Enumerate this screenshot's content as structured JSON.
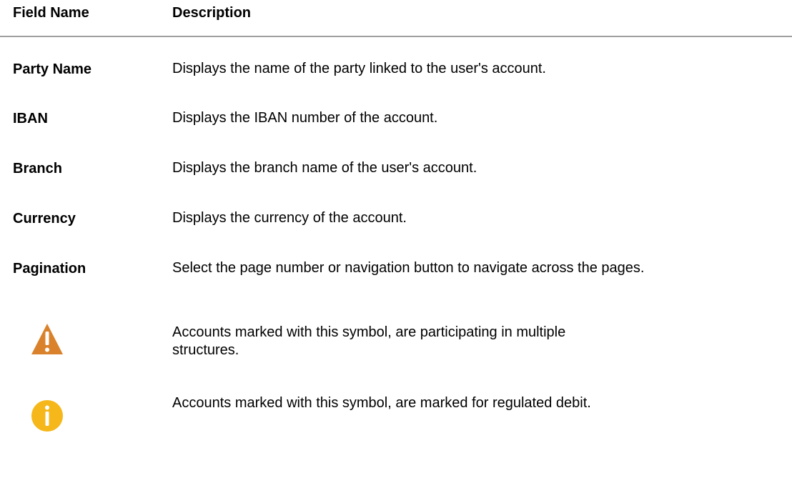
{
  "header": {
    "field_name": "Field Name",
    "description": "Description"
  },
  "rows": [
    {
      "field": "Party Name",
      "description": "Displays the name of the party linked to the user's account."
    },
    {
      "field": "IBAN",
      "description": "Displays the IBAN number of the account."
    },
    {
      "field": "Branch",
      "description": "Displays the branch name of the user's account."
    },
    {
      "field": "Currency",
      "description": "Displays the currency of the account."
    },
    {
      "field": "Pagination",
      "description": "Select the page number or navigation button to navigate across the pages."
    }
  ],
  "icon_rows": [
    {
      "icon": "warning-icon",
      "color": "#d9822b",
      "description": "Accounts marked with this symbol, are participating in multiple structures."
    },
    {
      "icon": "info-icon",
      "color": "#f5b71a",
      "description": "Accounts marked with this symbol, are marked for regulated debit."
    }
  ]
}
